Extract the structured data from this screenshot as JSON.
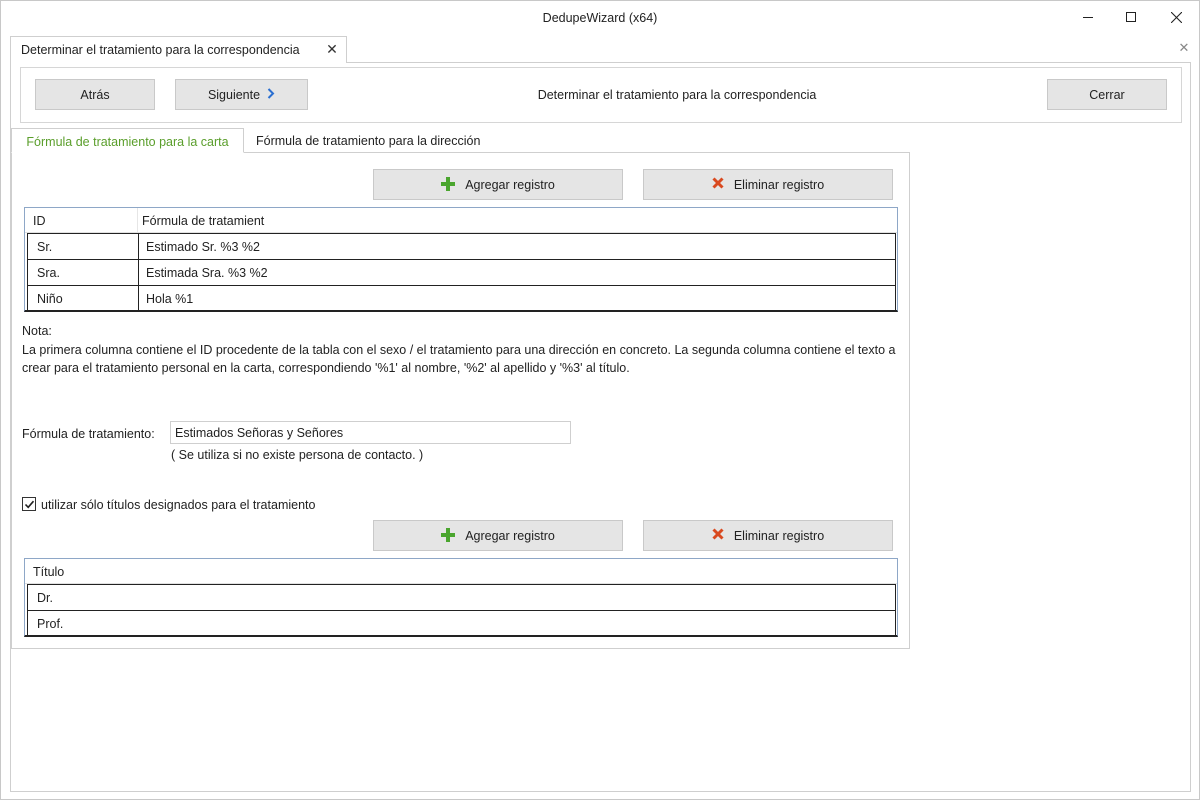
{
  "window": {
    "title": "DedupeWizard  (x64)"
  },
  "doc_tab": {
    "label": "Determinar el tratamiento para la correspondencia",
    "close_glyph": "✕"
  },
  "toolbar": {
    "back_label": "Atrás",
    "next_label": "Siguiente",
    "title": "Determinar el tratamiento para la correspondencia",
    "close_label": "Cerrar"
  },
  "tabs": [
    {
      "label": "Fórmula de tratamiento para la carta",
      "active": true
    },
    {
      "label": "Fórmula de tratamiento para la dirección",
      "active": false
    }
  ],
  "actions": {
    "add_label": "Agregar registro",
    "delete_label": "Eliminar registro"
  },
  "salutation_table": {
    "columns": [
      "ID",
      "Fórmula de tratamient"
    ],
    "rows": [
      [
        "Sr.",
        "Estimado Sr. %3 %2"
      ],
      [
        "Sra.",
        "Estimada Sra. %3 %2"
      ],
      [
        "Niño",
        "Hola %1"
      ]
    ]
  },
  "note": {
    "title": "Nota:",
    "body": "La primera columna contiene el ID procedente de la tabla con el sexo / el tratamiento para una dirección en concreto. La segunda columna contiene el texto a crear para el tratamiento personal en la carta, correspondiendo '%1' al nombre, '%2' al apellido y '%3' al título."
  },
  "formula": {
    "label": "Fórmula de tratamiento:",
    "value": "Estimados Señoras y Señores",
    "hint": "( Se utiliza si no existe persona de contacto. )"
  },
  "titles_option": {
    "label": "utilizar sólo títulos designados para el tratamiento",
    "checked": true
  },
  "titles_table": {
    "columns": [
      "Título"
    ],
    "rows": [
      [
        "Dr."
      ],
      [
        "Prof."
      ]
    ]
  },
  "colors": {
    "active_tab": "#5a9e2b",
    "add_icon": "#4aa52e",
    "delete_icon": "#d9491f",
    "next_chevron": "#2a6fd1",
    "button_bg": "#e5e5e5"
  },
  "icons": {
    "add": "plus-icon",
    "delete": "cross-icon",
    "next": "chevron-right-icon"
  }
}
